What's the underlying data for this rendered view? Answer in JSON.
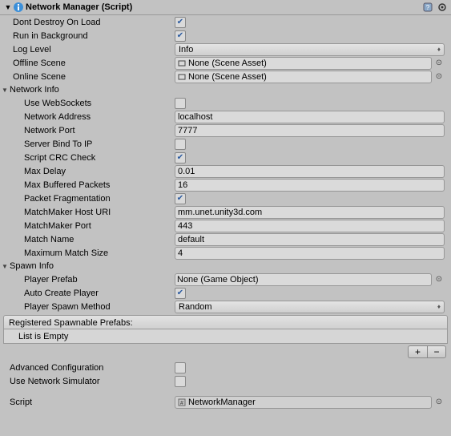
{
  "header": {
    "title": "Network Manager (Script)"
  },
  "props": {
    "dontDestroy": "Dont Destroy On Load",
    "runInBg": "Run in Background",
    "logLevel": {
      "label": "Log Level",
      "value": "Info"
    },
    "offlineScene": {
      "label": "Offline Scene",
      "value": "None (Scene Asset)"
    },
    "onlineScene": {
      "label": "Online Scene",
      "value": "None (Scene Asset)"
    }
  },
  "netInfo": {
    "section": "Network Info",
    "useWebSockets": "Use WebSockets",
    "networkAddress": {
      "label": "Network Address",
      "value": "localhost"
    },
    "networkPort": {
      "label": "Network Port",
      "value": "7777"
    },
    "serverBind": "Server Bind To IP",
    "crcCheck": "Script CRC Check",
    "maxDelay": {
      "label": "Max Delay",
      "value": "0.01"
    },
    "maxBuffered": {
      "label": "Max Buffered Packets",
      "value": "16"
    },
    "packetFrag": "Packet Fragmentation",
    "mmHost": {
      "label": "MatchMaker Host URI",
      "value": "mm.unet.unity3d.com"
    },
    "mmPort": {
      "label": "MatchMaker Port",
      "value": "443"
    },
    "matchName": {
      "label": "Match Name",
      "value": "default"
    },
    "matchSize": {
      "label": "Maximum Match Size",
      "value": "4"
    }
  },
  "spawnInfo": {
    "section": "Spawn Info",
    "playerPrefab": {
      "label": "Player Prefab",
      "value": "None (Game Object)"
    },
    "autoCreate": "Auto Create Player",
    "spawnMethod": {
      "label": "Player Spawn Method",
      "value": "Random"
    },
    "regTitle": "Registered Spawnable Prefabs:",
    "regEmpty": "List is Empty"
  },
  "advanced": "Advanced Configuration",
  "simulator": "Use Network Simulator",
  "script": {
    "label": "Script",
    "value": "NetworkManager"
  }
}
